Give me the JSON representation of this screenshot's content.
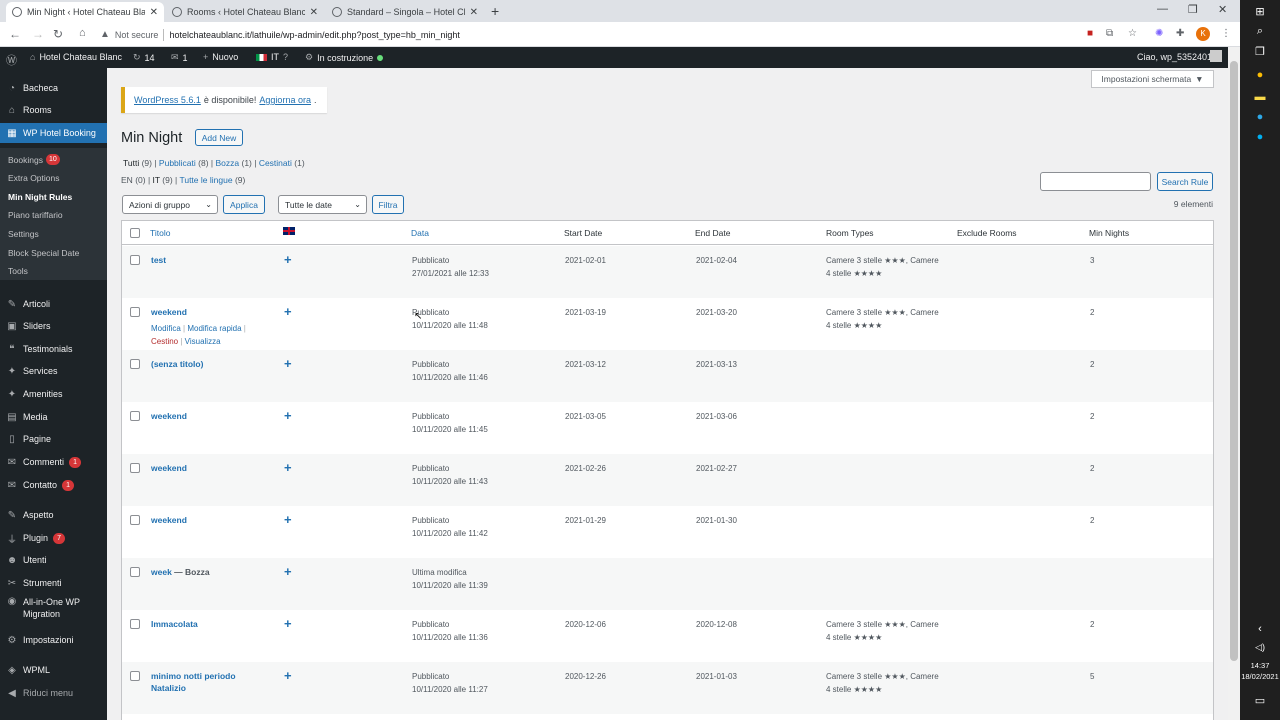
{
  "browser": {
    "tabs": [
      {
        "title": "Min Night ‹ Hotel Chateau Blanc"
      },
      {
        "title": "Rooms ‹ Hotel Chateau Blanc —"
      },
      {
        "title": "Standard – Singola – Hotel Chate"
      }
    ],
    "not_secure": "Not secure",
    "url": "hotelchateaublanc.it/lathuile/wp-admin/edit.php?post_type=hb_min_night",
    "profile_initial": "K"
  },
  "adminbar": {
    "site": "Hotel Chateau Blanc",
    "updates": "14",
    "comments": "1",
    "new": "Nuovo",
    "lang": "IT",
    "status": "In costruzione",
    "greeting": "Ciao, wp_5352401"
  },
  "sidebar": {
    "top": [
      {
        "label": "Bacheca",
        "icon": "dashboard-icon"
      },
      {
        "label": "Rooms",
        "icon": "rooms-icon"
      }
    ],
    "current": "WP Hotel Booking",
    "submenu": [
      {
        "label": "Bookings",
        "badge": "10"
      },
      {
        "label": "Extra Options"
      },
      {
        "label": "Min Night Rules"
      },
      {
        "label": "Piano tariffario"
      },
      {
        "label": "Settings"
      },
      {
        "label": "Block Special Date"
      },
      {
        "label": "Tools"
      }
    ],
    "items": [
      {
        "label": "Articoli"
      },
      {
        "label": "Sliders"
      },
      {
        "label": "Testimonials"
      },
      {
        "label": "Services"
      },
      {
        "label": "Amenities"
      },
      {
        "label": "Media"
      },
      {
        "label": "Pagine"
      },
      {
        "label": "Commenti",
        "badge": "1"
      },
      {
        "label": "Contatto",
        "badge": "1"
      },
      {
        "label": "Aspetto"
      },
      {
        "label": "Plugin",
        "badge": "7"
      },
      {
        "label": "Utenti"
      },
      {
        "label": "Strumenti"
      },
      {
        "label": "All-in-One WP"
      },
      {
        "label": "Migration"
      },
      {
        "label": "Impostazioni"
      },
      {
        "label": "WPML"
      },
      {
        "label": "Riduci menu"
      }
    ]
  },
  "main": {
    "screen_options": "Impostazioni schermata",
    "notice_link": "WordPress 5.6.1",
    "notice_text": "è disponibile!",
    "notice_update": "Aggiorna ora",
    "notice_end": ".",
    "title": "Min Night",
    "add_new": "Add New",
    "status_filters": {
      "all": "Tutti",
      "all_n": "(9)",
      "published": "Pubblicati",
      "published_n": "(8)",
      "draft": "Bozza",
      "draft_n": "(1)",
      "trash": "Cestinati",
      "trash_n": "(1)"
    },
    "lang_filters": {
      "en": "EN",
      "en_n": "(0)",
      "it": "IT",
      "it_n": "(9)",
      "all": "Tutte le lingue",
      "all_n": "(9)"
    },
    "bulk_actions": "Azioni di gruppo",
    "apply": "Applica",
    "dates": "Tutte le date",
    "filter": "Filtra",
    "search_placeholder": "",
    "search_button": "Search Rule",
    "count": "9 elementi",
    "columns": {
      "title": "Titolo",
      "date": "Data",
      "start": "Start Date",
      "end": "End Date",
      "room_types": "Room Types",
      "exclude": "Exclude Rooms",
      "min_nights": "Min Nights"
    },
    "row_actions": {
      "edit": "Modifica",
      "quick": "Modifica rapida",
      "trash": "Cestino",
      "view": "Visualizza"
    },
    "rows": [
      {
        "title": "test",
        "status": "Pubblicato",
        "date": "27/01/2021 alle 12:33",
        "start": "2021-02-01",
        "end": "2021-02-04",
        "rt1": "Camere 3 stelle ★★★, Camere",
        "rt2": "4 stelle ★★★★",
        "min": "3"
      },
      {
        "title": "weekend",
        "status": "Pubblicato",
        "date": "10/11/2020 alle 11:48",
        "start": "2021-03-19",
        "end": "2021-03-20",
        "rt1": "Camere 3 stelle ★★★, Camere",
        "rt2": "4 stelle ★★★★",
        "min": "2"
      },
      {
        "title": "(senza titolo)",
        "status": "Pubblicato",
        "date": "10/11/2020 alle 11:46",
        "start": "2021-03-12",
        "end": "2021-03-13",
        "rt1": "",
        "rt2": "",
        "min": "2"
      },
      {
        "title": "weekend",
        "status": "Pubblicato",
        "date": "10/11/2020 alle 11:45",
        "start": "2021-03-05",
        "end": "2021-03-06",
        "rt1": "",
        "rt2": "",
        "min": "2"
      },
      {
        "title": "weekend",
        "status": "Pubblicato",
        "date": "10/11/2020 alle 11:43",
        "start": "2021-02-26",
        "end": "2021-02-27",
        "rt1": "",
        "rt2": "",
        "min": "2"
      },
      {
        "title": "weekend",
        "status": "Pubblicato",
        "date": "10/11/2020 alle 11:42",
        "start": "2021-01-29",
        "end": "2021-01-30",
        "rt1": "",
        "rt2": "",
        "min": "2"
      },
      {
        "title": "week",
        "draft": "— Bozza",
        "status": "Ultima modifica",
        "date": "10/11/2020 alle 11:39",
        "start": "",
        "end": "",
        "rt1": "",
        "rt2": "",
        "min": ""
      },
      {
        "title": "Immacolata",
        "status": "Pubblicato",
        "date": "10/11/2020 alle 11:36",
        "start": "2020-12-06",
        "end": "2020-12-08",
        "rt1": "Camere 3 stelle ★★★, Camere",
        "rt2": "4 stelle ★★★★",
        "min": "2"
      },
      {
        "title": "minimo notti periodo Natalizio",
        "status": "Pubblicato",
        "date": "10/11/2020 alle 11:27",
        "start": "2020-12-26",
        "end": "2021-01-03",
        "rt1": "Camere 3 stelle ★★★, Camere",
        "rt2": "4 stelle ★★★★",
        "min": "5"
      }
    ]
  },
  "taskbar": {
    "time": "14:37",
    "date": "18/02/2021"
  }
}
